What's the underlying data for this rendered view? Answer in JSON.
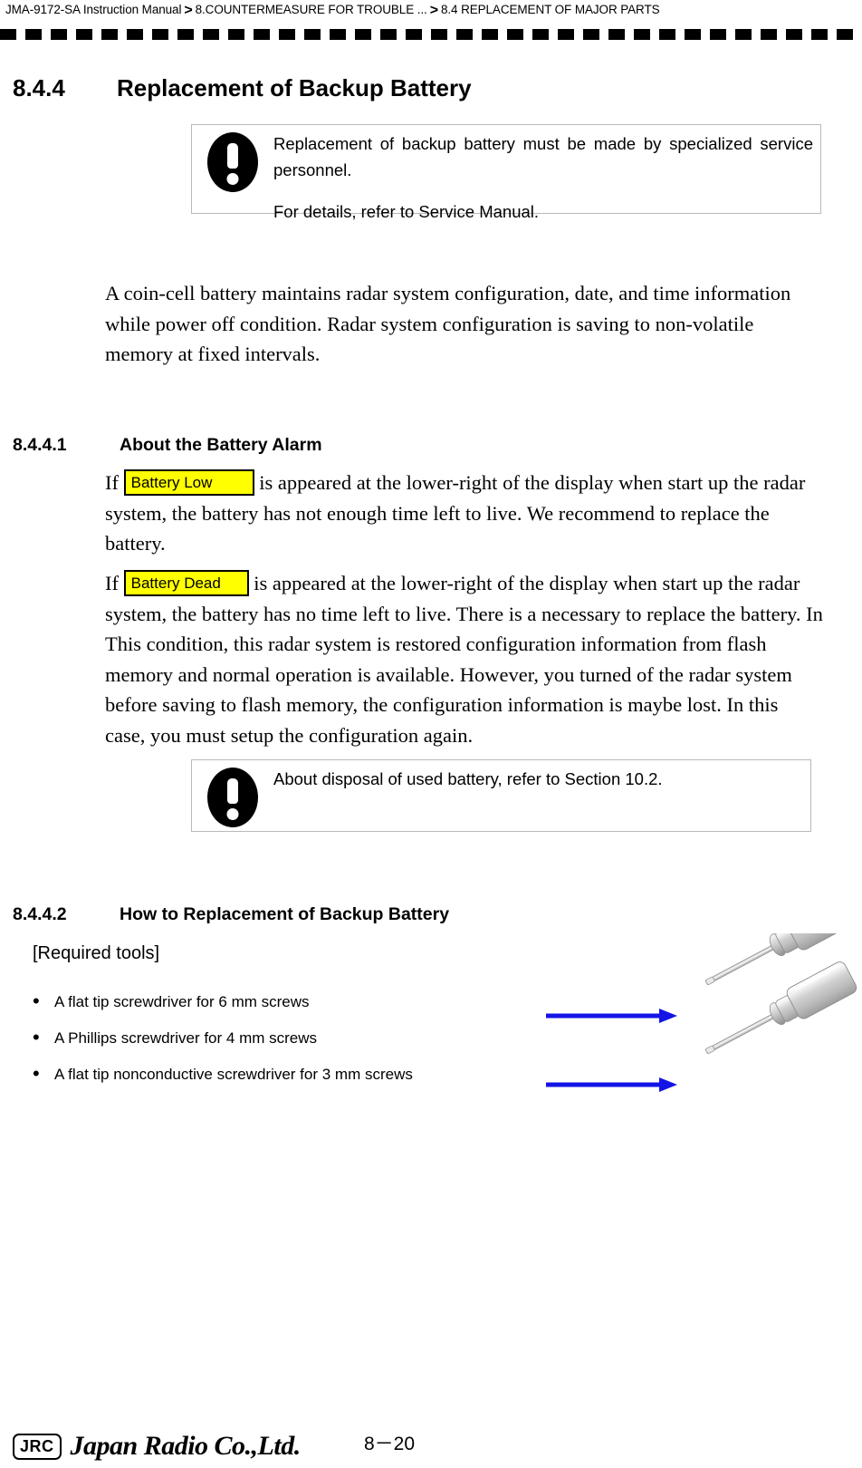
{
  "header": {
    "breadcrumb": [
      "JMA-9172-SA Instruction Manual",
      "8.COUNTERMEASURE FOR TROUBLE ...",
      "8.4  REPLACEMENT OF MAJOR PARTS"
    ],
    "separator": ">"
  },
  "section_844": {
    "number": "8.4.4",
    "title": "Replacement of Backup Battery",
    "note": {
      "line1": "Replacement of backup battery must be made by specialized service personnel.",
      "line2": "For details, refer to Service Manual."
    },
    "paragraph": "A coin-cell battery maintains radar system configuration, date, and time information while power off condition. Radar system configuration is saving to non-volatile memory at fixed intervals."
  },
  "section_8441": {
    "number": "8.4.4.1",
    "title": "About the Battery Alarm",
    "alarm_low": {
      "lead": "If",
      "badge": "Battery Low",
      "rest": "is appeared at the lower-right of the display when start up the radar system, the battery has not enough time left to live. We recommend to replace the battery."
    },
    "alarm_dead": {
      "lead": "If",
      "badge": "Battery Dead",
      "rest": "is appeared at the lower-right of the display when start up the radar system, the battery has no time left to live. There is a necessary to replace the battery. In This condition, this radar system is restored configuration information from flash memory and normal operation is available. However, you turned of the radar system before saving to flash memory, the configuration information is maybe lost. In this case, you must setup the configuration again."
    },
    "note": {
      "line1": "About disposal of used battery, refer to Section 10.2."
    }
  },
  "section_8442": {
    "number": "8.4.4.2",
    "title": "How to Replacement of Backup Battery",
    "required_tools_label": "[Required tools]",
    "tools": [
      "A flat tip screwdriver for 6 mm screws",
      "A Phillips screwdriver for 4 mm screws",
      "A flat tip nonconductive screwdriver for 3 mm screws"
    ]
  },
  "footer": {
    "logo_mark": "JRC",
    "company": "Japan Radio Co.,Ltd.",
    "page_number": "8－20"
  },
  "colors": {
    "alarm_badge_bg": "#ffff00",
    "alarm_badge_border": "#000000",
    "arrow": "#1414e6",
    "note_border": "#b9b9b9",
    "screwdriver_body": "#d6d6d6"
  }
}
